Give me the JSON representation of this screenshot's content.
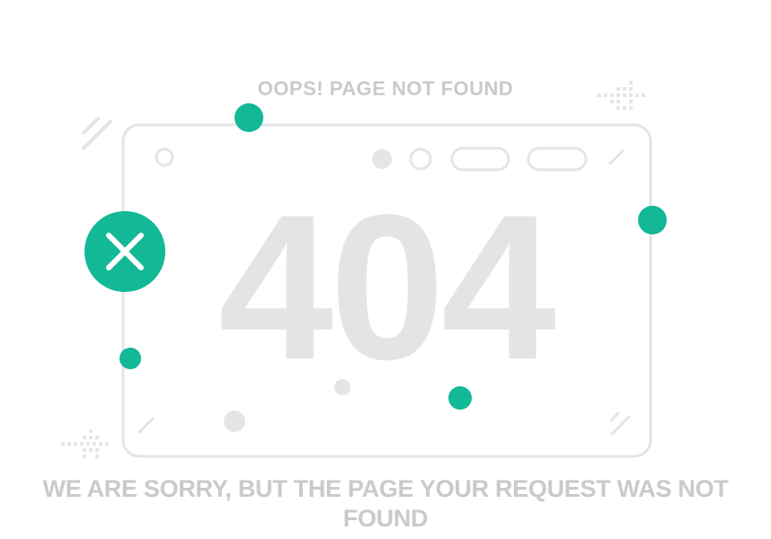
{
  "error": {
    "heading": "OOPS! PAGE NOT FOUND",
    "code": "404",
    "message": "WE ARE SORRY, BUT THE PAGE YOUR REQUEST WAS NOT FOUND"
  },
  "icons": {
    "error_badge": "close-icon"
  },
  "colors": {
    "accent": "#13b896",
    "outline": "#e3e5e6",
    "heading_text": "#c8cacb",
    "code_text": "#e2e4e5"
  }
}
